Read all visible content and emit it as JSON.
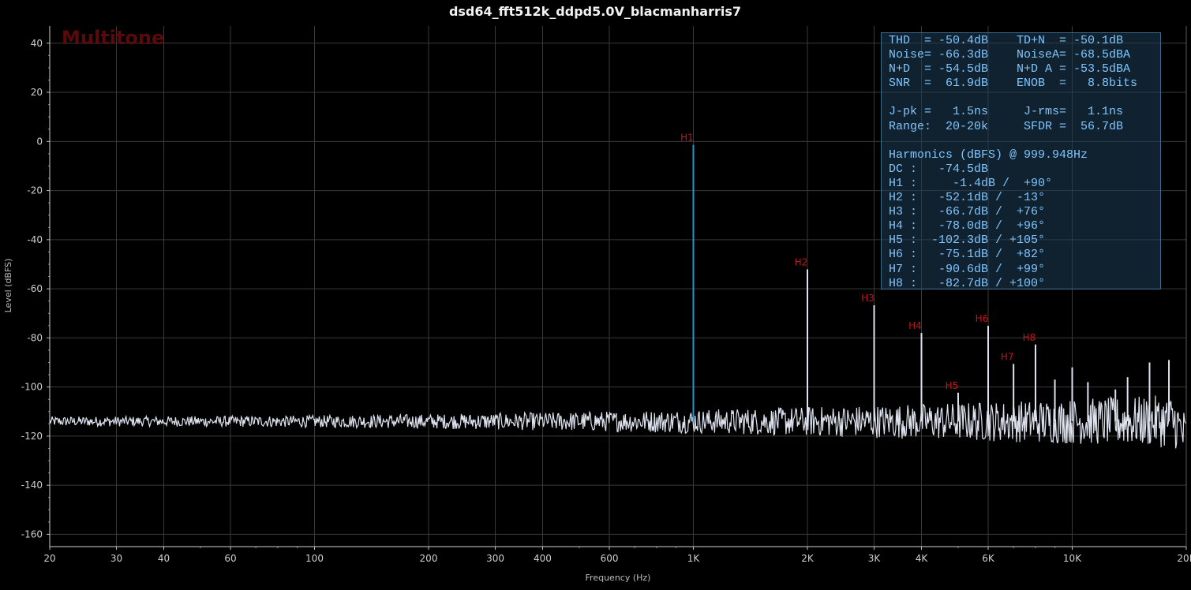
{
  "chart_data": {
    "type": "line",
    "title": "dsd64_fft512k_ddpd5.0V_blacmanharris7",
    "xlabel": "Frequency (Hz)",
    "ylabel": "Level (dBFS)",
    "xscale": "log",
    "xlim": [
      20,
      20000
    ],
    "ylim": [
      -165,
      47
    ],
    "x_ticks": [
      20,
      30,
      40,
      60,
      100,
      200,
      300,
      400,
      600,
      1000,
      2000,
      3000,
      4000,
      6000,
      10000,
      20000
    ],
    "x_tick_labels": [
      "20",
      "30",
      "40",
      "60",
      "100",
      "200",
      "300",
      "400",
      "600",
      "1K",
      "2K",
      "3K",
      "4K",
      "6K",
      "10K",
      "20K"
    ],
    "y_ticks": [
      40,
      20,
      0,
      -20,
      -40,
      -60,
      -80,
      -100,
      -120,
      -140,
      -160
    ],
    "y_tick_labels": [
      "40",
      "20",
      "0",
      "-20",
      "-40",
      "-60",
      "-80",
      "-100",
      "-120",
      "-140",
      "-160"
    ],
    "grid": true,
    "watermark": "Multitone",
    "noise_floor_db": -114,
    "harmonics": [
      {
        "label": "H1",
        "freq": 1000,
        "level": -1.4
      },
      {
        "label": "H2",
        "freq": 2000,
        "level": -52.1
      },
      {
        "label": "H3",
        "freq": 3000,
        "level": -66.7
      },
      {
        "label": "H4",
        "freq": 4000,
        "level": -78.0
      },
      {
        "label": "H5",
        "freq": 5000,
        "level": -102.3
      },
      {
        "label": "H6",
        "freq": 6000,
        "level": -75.1
      },
      {
        "label": "H7",
        "freq": 7000,
        "level": -90.6
      },
      {
        "label": "H8",
        "freq": 8000,
        "level": -82.7
      }
    ],
    "extra_spurs": [
      {
        "freq": 9000,
        "level": -97
      },
      {
        "freq": 10000,
        "level": -92
      },
      {
        "freq": 11000,
        "level": -98
      },
      {
        "freq": 13000,
        "level": -101
      },
      {
        "freq": 14000,
        "level": -96
      },
      {
        "freq": 16000,
        "level": -90
      },
      {
        "freq": 18000,
        "level": -89
      }
    ],
    "colors": {
      "background": "#000000",
      "grid": "#3a3a3a",
      "fundamental": "#2b93c8",
      "spectrum": "#dde2ee",
      "harmonic_label": "#c01818"
    }
  },
  "stats_panel": {
    "lines": [
      "THD  = -50.4dB    TD+N  = -50.1dB",
      "Noise= -66.3dB    NoiseA= -68.5dBA",
      "N+D  = -54.5dB    N+D A = -53.5dBA",
      "SNR  =  61.9dB    ENOB  =   8.8bits",
      "",
      "J-pk =   1.5ns     J-rms=   1.1ns",
      "Range:  20-20k     SFDR =  56.7dB",
      "",
      "Harmonics (dBFS) @ 999.948Hz",
      "DC :   -74.5dB",
      "H1 :     -1.4dB /  +90°",
      "H2 :   -52.1dB /  -13°",
      "H3 :   -66.7dB /  +76°",
      "H4 :   -78.0dB /  +96°",
      "H5 :  -102.3dB / +105°",
      "H6 :   -75.1dB /  +82°",
      "H7 :   -90.6dB /  +99°",
      "H8 :   -82.7dB / +100°"
    ]
  }
}
